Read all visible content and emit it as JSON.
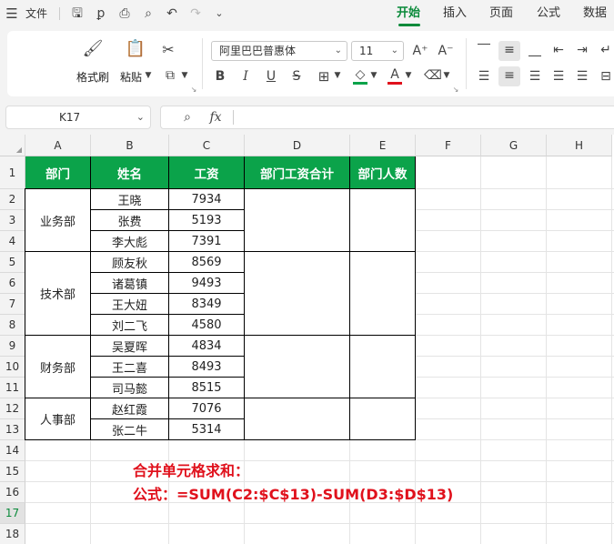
{
  "menubar": {
    "menu_icon": "hamburger-icon",
    "file_label": "文件",
    "tabs": [
      "开始",
      "插入",
      "页面",
      "公式",
      "数据"
    ],
    "active_tab": "开始"
  },
  "ribbon": {
    "format_painter_label": "格式刷",
    "paste_label": "粘贴",
    "font_name": "阿里巴巴普惠体",
    "font_size": "11",
    "bold": "B",
    "italic": "I",
    "underline": "U",
    "font_color_glyph": "A",
    "grow_font": "A⁺",
    "shrink_font": "A⁻",
    "fill_color": "#0ba34a",
    "font_color": "#e0111c"
  },
  "formula_bar": {
    "name_box": "K17",
    "fx_label": "fx",
    "formula": ""
  },
  "sheet": {
    "columns": [
      "A",
      "B",
      "C",
      "D",
      "E",
      "F",
      "G",
      "H"
    ],
    "rows": [
      "1",
      "2",
      "3",
      "4",
      "5",
      "6",
      "7",
      "8",
      "9",
      "10",
      "11",
      "12",
      "13",
      "14",
      "15",
      "16",
      "17",
      "18"
    ],
    "selected_row": "17",
    "headers": [
      "部门",
      "姓名",
      "工资",
      "部门工资合计",
      "部门人数"
    ],
    "departments": [
      "业务部",
      "技术部",
      "财务部",
      "人事部"
    ],
    "names": [
      "王晓",
      "张费",
      "李大彪",
      "顾友秋",
      "诸葛镇",
      "王大妞",
      "刘二飞",
      "吴夏晖",
      "王二喜",
      "司马懿",
      "赵红霞",
      "张二牛"
    ],
    "salaries": [
      "7934",
      "5193",
      "7391",
      "8569",
      "9493",
      "8349",
      "4580",
      "4834",
      "8493",
      "8515",
      "7076",
      "5314"
    ]
  },
  "notes": {
    "line1": "合并单元格求和：",
    "line2": "公式：=SUM(C2:$C$13)-SUM(D3:$D$13)"
  }
}
